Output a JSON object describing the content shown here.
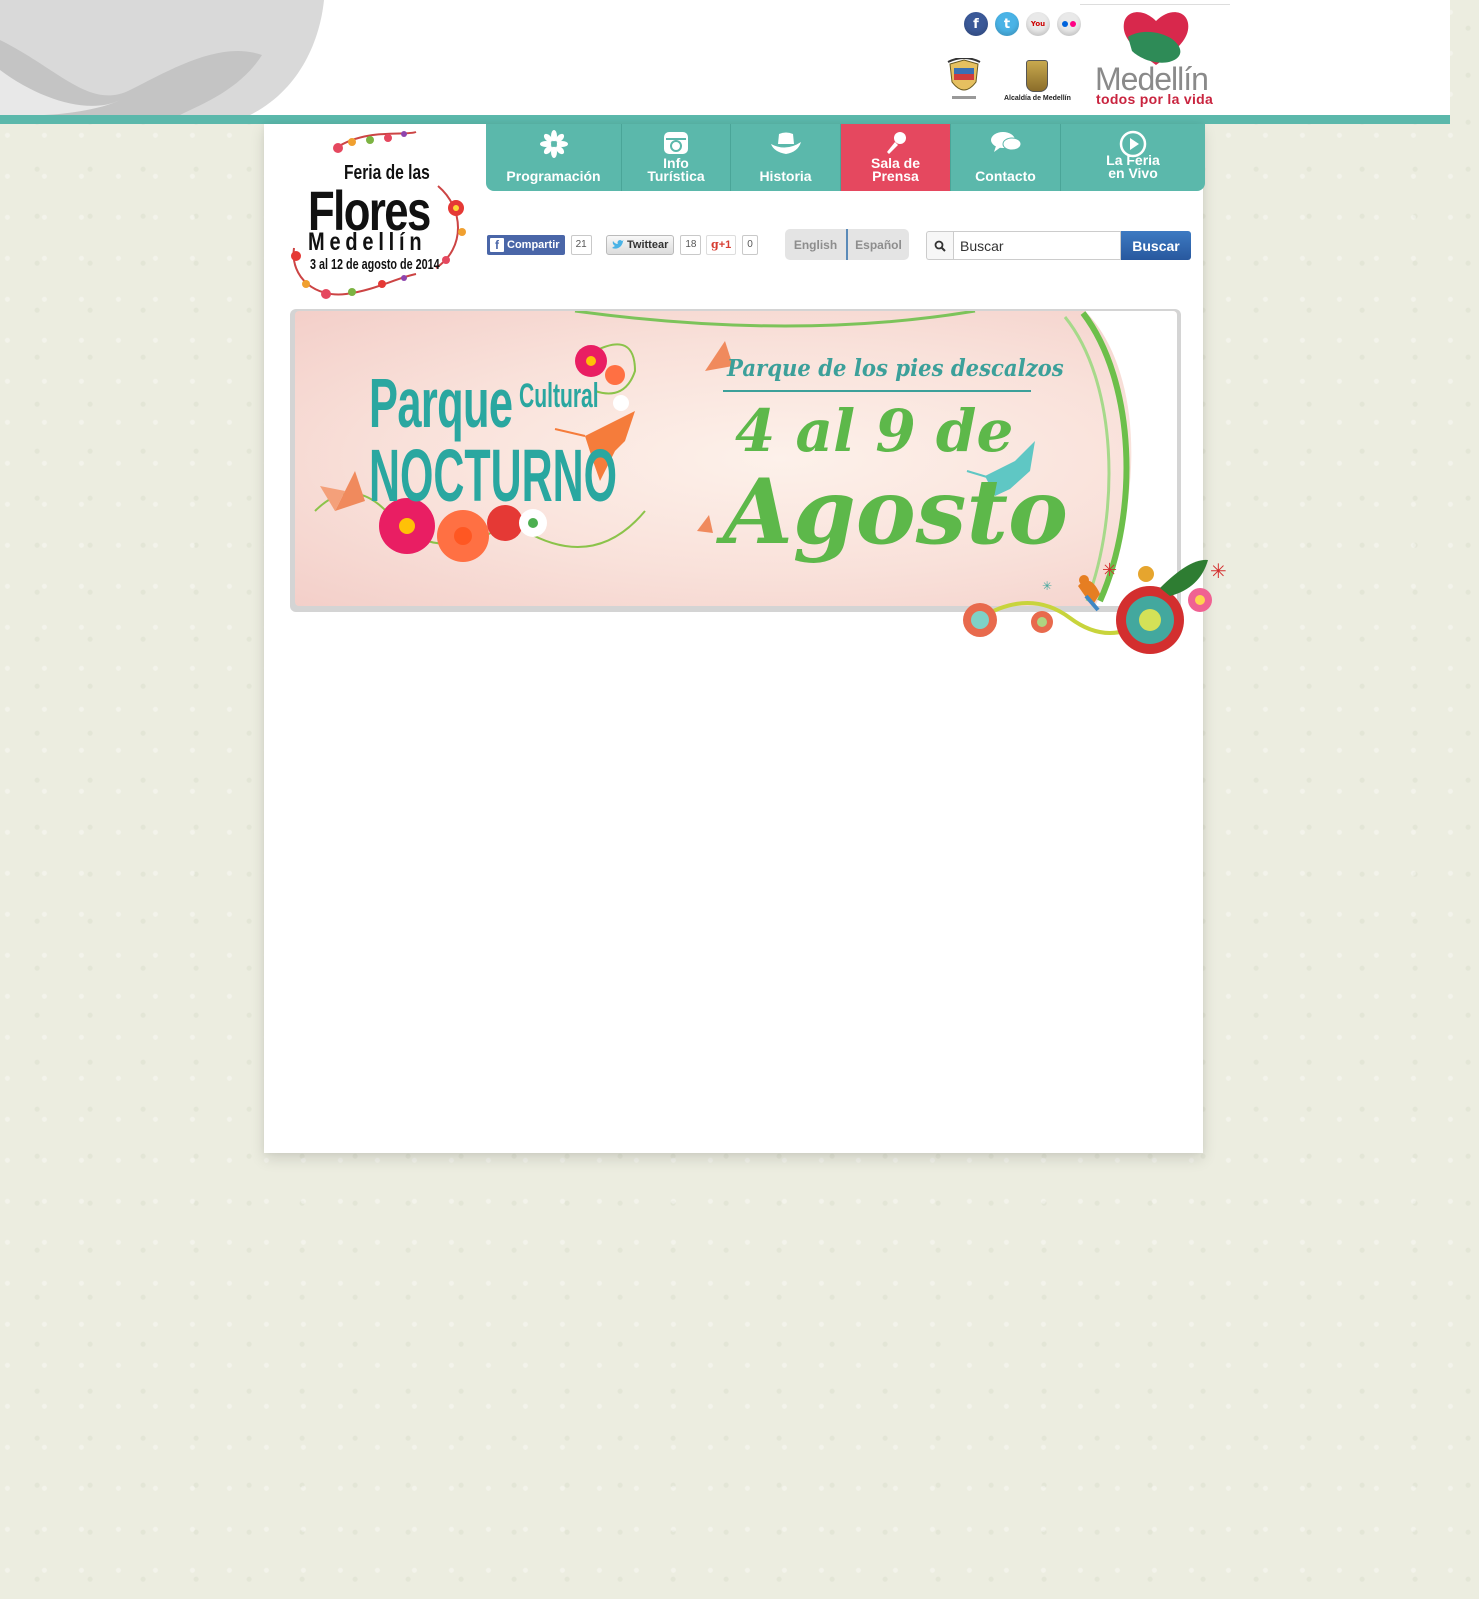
{
  "header": {
    "social": [
      {
        "name": "facebook-icon",
        "glyph": "f"
      },
      {
        "name": "twitter-icon",
        "glyph": "t"
      },
      {
        "name": "youtube-icon",
        "glyph": "You"
      },
      {
        "name": "flickr-icon",
        "glyph": ""
      }
    ],
    "alcaldia_label": "Alcaldía de Medellín",
    "medellin_name": "Medellín",
    "medellin_tagline": "todos por la vida"
  },
  "fair_logo": {
    "line1": "Feria de las",
    "line2": "Flores",
    "line3": "Medellín",
    "line4": "3 al 12 de agosto de 2014"
  },
  "nav": {
    "items": [
      {
        "label": "Programación",
        "icon": "flower-icon",
        "active": false
      },
      {
        "label": "Info\nTurística",
        "icon": "camera-icon",
        "active": false
      },
      {
        "label": "Historia",
        "icon": "hat-icon",
        "active": false
      },
      {
        "label": "Sala de\nPrensa",
        "icon": "microphone-icon",
        "active": true
      },
      {
        "label": "Contacto",
        "icon": "chat-icon",
        "active": false
      },
      {
        "label": "La Feria\nen Vivo",
        "icon": "play-icon",
        "active": false
      }
    ]
  },
  "share": {
    "facebook_label": "Compartir",
    "facebook_count": "21",
    "twitter_label": "Twittear",
    "twitter_count": "18",
    "gplus_label": "+1",
    "gplus_count": "0"
  },
  "language": {
    "english": "English",
    "spanish": "Español"
  },
  "search": {
    "value": "Buscar",
    "button_label": "Buscar"
  },
  "banner": {
    "title_parque": "Parque",
    "title_cultural": "Cultural",
    "title_nocturno": "NOCTURNO",
    "place": "Parque de los pies descalzos",
    "dates": "4 al 9 de",
    "month": "Agosto"
  },
  "colors": {
    "teal": "#5bb8ab",
    "active_pink": "#e5485f",
    "banner_teal": "#2aa7a0",
    "banner_green": "#5db84a"
  }
}
